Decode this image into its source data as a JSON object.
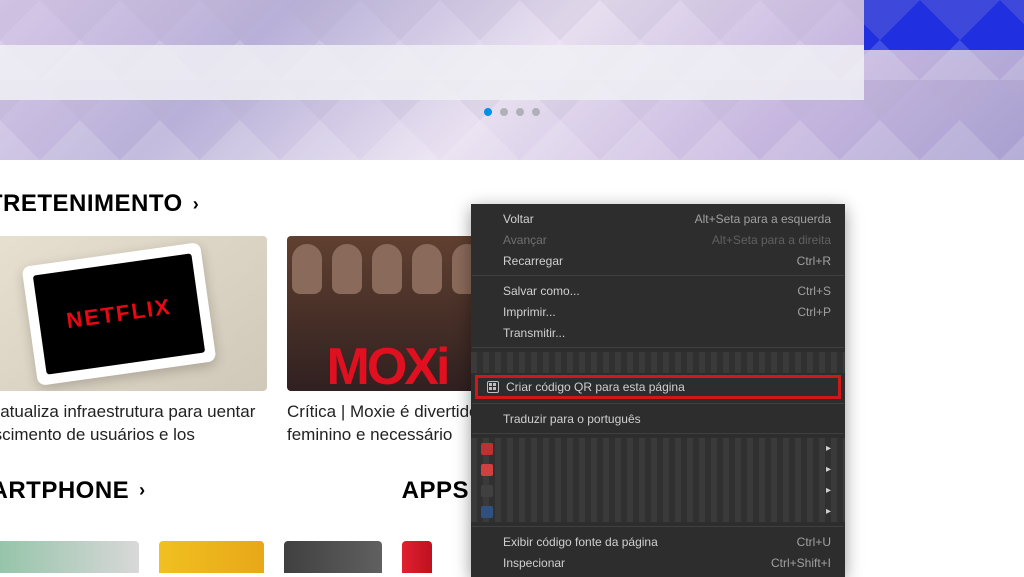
{
  "carousel": {
    "dot_count": 4,
    "active_index": 0
  },
  "sections": {
    "entertainment": {
      "title": "NTRETENIMENTO",
      "chevron": "›"
    },
    "smartphone": {
      "title": "MARTPHONE",
      "chevron": "›"
    },
    "apps": {
      "title": "APPS",
      "chevron": "›"
    }
  },
  "cards": {
    "netflix": {
      "logo": "NETFLIX",
      "title": "tflix atualiza infraestrutura para uentar crescimento de usuários e los"
    },
    "moxie": {
      "text": "MOXi",
      "title": "Crítica | Moxie é divertido, feminino e necessário"
    }
  },
  "context_menu": {
    "items": {
      "back": {
        "label": "Voltar",
        "shortcut": "Alt+Seta para a esquerda"
      },
      "forward": {
        "label": "Avançar",
        "shortcut": "Alt+Seta para a direita"
      },
      "reload": {
        "label": "Recarregar",
        "shortcut": "Ctrl+R"
      },
      "save_as": {
        "label": "Salvar como...",
        "shortcut": "Ctrl+S"
      },
      "print": {
        "label": "Imprimir...",
        "shortcut": "Ctrl+P"
      },
      "cast": {
        "label": "Transmitir..."
      },
      "qr": {
        "label": "Criar código QR para esta página"
      },
      "translate": {
        "label": "Traduzir para o português"
      },
      "view_source": {
        "label": "Exibir código fonte da página",
        "shortcut": "Ctrl+U"
      },
      "inspect": {
        "label": "Inspecionar",
        "shortcut": "Ctrl+Shift+I"
      }
    }
  }
}
